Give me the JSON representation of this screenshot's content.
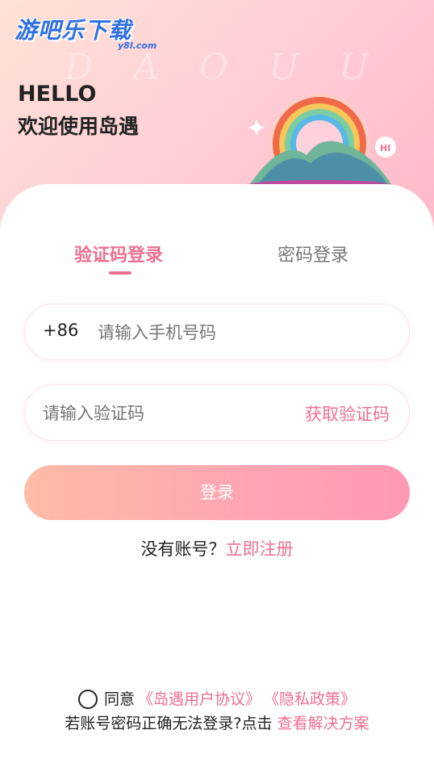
{
  "brand": {
    "name": "游吧乐下载",
    "sub": "y8l.com",
    "watermark": "D A O U U"
  },
  "greeting": {
    "hello": "HELLO",
    "welcome": "欢迎使用岛遇"
  },
  "illustration": {
    "bubble_text": "HI"
  },
  "tabs": {
    "active": "验证码登录",
    "inactive": "密码登录"
  },
  "form": {
    "phone_prefix": "+86",
    "phone_placeholder": "请输入手机号码",
    "code_placeholder": "请输入验证码",
    "get_code": "获取验证码",
    "login_button": "登录"
  },
  "signup": {
    "prompt": "没有账号？",
    "link": "立即注册"
  },
  "agreement": {
    "agree": "同意",
    "user_agreement": "《岛遇用户协议》",
    "privacy_policy": "《隐私政策》",
    "help_prompt": "若账号密码正确无法登录?点击",
    "help_link": "查看解决方案"
  },
  "colors": {
    "accent": "#ef6f91",
    "hero_start": "#ffe2d6",
    "hero_end": "#ffb6c8",
    "button_start": "#ffbca6",
    "button_end": "#ff99b5"
  }
}
